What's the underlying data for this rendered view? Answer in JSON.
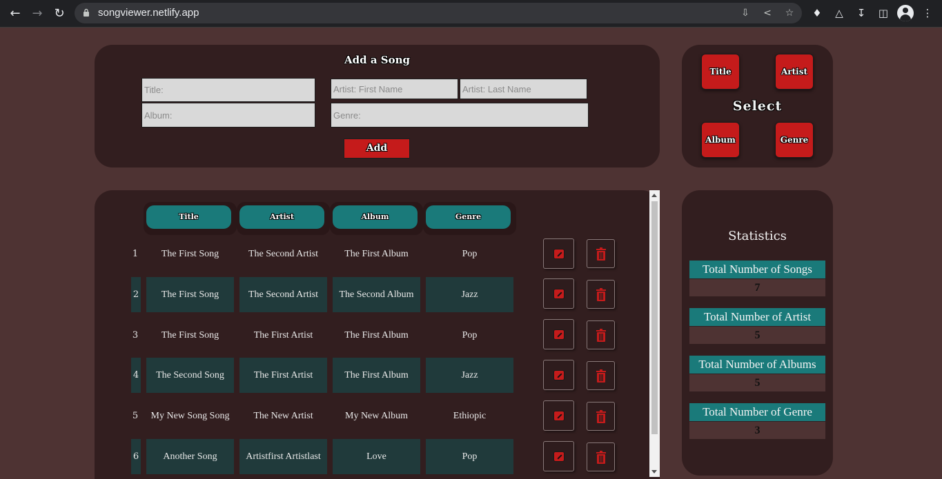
{
  "browser": {
    "url": "songviewer.netlify.app"
  },
  "add_form": {
    "title": "Add a Song",
    "title_placeholder": "Title:",
    "first_name_placeholder": "Artist: First Name",
    "last_name_placeholder": "Artist: Last Name",
    "album_placeholder": "Album:",
    "genre_placeholder": "Genre:",
    "add_label": "Add"
  },
  "select_panel": {
    "label": "Select",
    "buttons": [
      "Title",
      "Artist",
      "Album",
      "Genre"
    ]
  },
  "table": {
    "headers": [
      "Title",
      "Artist",
      "Album",
      "Genre"
    ],
    "rows": [
      {
        "num": "1",
        "title": "The First Song",
        "artist": "The Second Artist",
        "album": "The First Album",
        "genre": "Pop"
      },
      {
        "num": "2",
        "title": "The First Song",
        "artist": "The Second Artist",
        "album": "The Second Album",
        "genre": "Jazz"
      },
      {
        "num": "3",
        "title": "The First Song",
        "artist": "The First Artist",
        "album": "The First Album",
        "genre": "Pop"
      },
      {
        "num": "4",
        "title": "The Second Song",
        "artist": "The First Artist",
        "album": "The First Album",
        "genre": "Jazz"
      },
      {
        "num": "5",
        "title": "My New Song Song",
        "artist": "The New Artist",
        "album": "My New Album",
        "genre": "Ethiopic"
      },
      {
        "num": "6",
        "title": "Another Song",
        "artist": "Artistfirst Artistlast",
        "album": "Love",
        "genre": "Pop"
      }
    ]
  },
  "stats": {
    "title": "Statistics",
    "items": [
      {
        "label": "Total Number of Songs",
        "value": "7"
      },
      {
        "label": "Total Number of Artist",
        "value": "5"
      },
      {
        "label": "Total Number of Albums",
        "value": "5"
      },
      {
        "label": "Total Number of Genre",
        "value": "3"
      }
    ]
  },
  "colors": {
    "background": "#4e3333",
    "panel": "#321e1f",
    "accent_teal": "#1a7a7a",
    "accent_red": "#c51b1b",
    "row_stripe": "#203a3b"
  }
}
